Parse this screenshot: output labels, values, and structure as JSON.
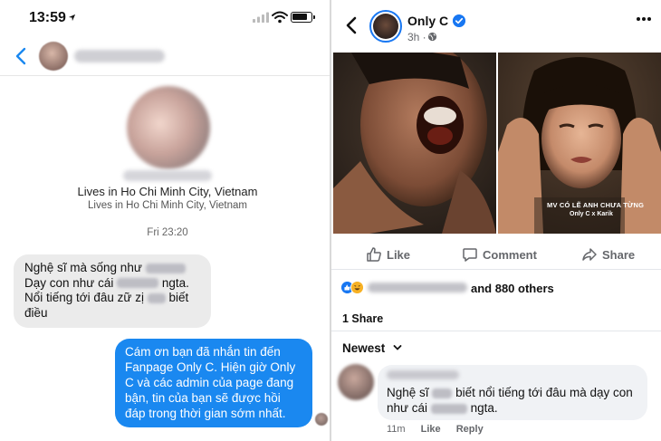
{
  "messenger": {
    "status_time": "13:59",
    "battery_level": 0.85,
    "profile_location_primary": "Lives in Ho Chi Minh City, Vietnam",
    "profile_location_secondary": "Lives in Ho Chi Minh City, Vietnam",
    "timestamp": "Fri 23:20",
    "incoming_message": {
      "line1_start": "Nghệ sĩ mà sống như",
      "line2_start": "Dạy con như cái",
      "line2_end": "ngta.",
      "line3_start": "Nổi tiếng tới đâu zữ zị",
      "line3_end": "biết",
      "line4": "điều"
    },
    "outgoing_message": "Cám ơn bạn đã nhắn tin đến Fanpage Only C. Hiện giờ Only C và các admin của page đang bận, tin của bạn sẽ được hồi đáp trong thời gian sớm nhất."
  },
  "facebook": {
    "page_name": "Only C",
    "post_time": "3h ·",
    "video_caption_line1": "MV CÓ LẼ ANH CHƯA TỪNG",
    "video_caption_line2": "Only C x Karik",
    "actions": {
      "like": "Like",
      "comment": "Comment",
      "share": "Share"
    },
    "reactions_text": "and 880 others",
    "shares_text": "1 Share",
    "sort_label": "Newest",
    "comment": {
      "text_start": "Nghệ sĩ",
      "text_mid": "biết nổi tiếng tới đâu mà dạy con như cái",
      "text_end": "ngta.",
      "time": "11m",
      "like": "Like",
      "reply": "Reply"
    }
  },
  "colors": {
    "messenger_blue": "#1a88f0",
    "facebook_blue": "#1877f2",
    "bubble_gray": "#ebebeb",
    "comment_gray": "#f0f2f5"
  },
  "icons": [
    "location-arrow-icon",
    "signal-icon",
    "wifi-icon",
    "battery-icon",
    "back-chevron-icon",
    "verified-badge-icon",
    "globe-icon",
    "more-options-icon",
    "like-thumb-icon",
    "comment-bubble-icon",
    "share-arrow-icon",
    "like-reaction-icon",
    "haha-reaction-icon",
    "chevron-down-icon"
  ]
}
